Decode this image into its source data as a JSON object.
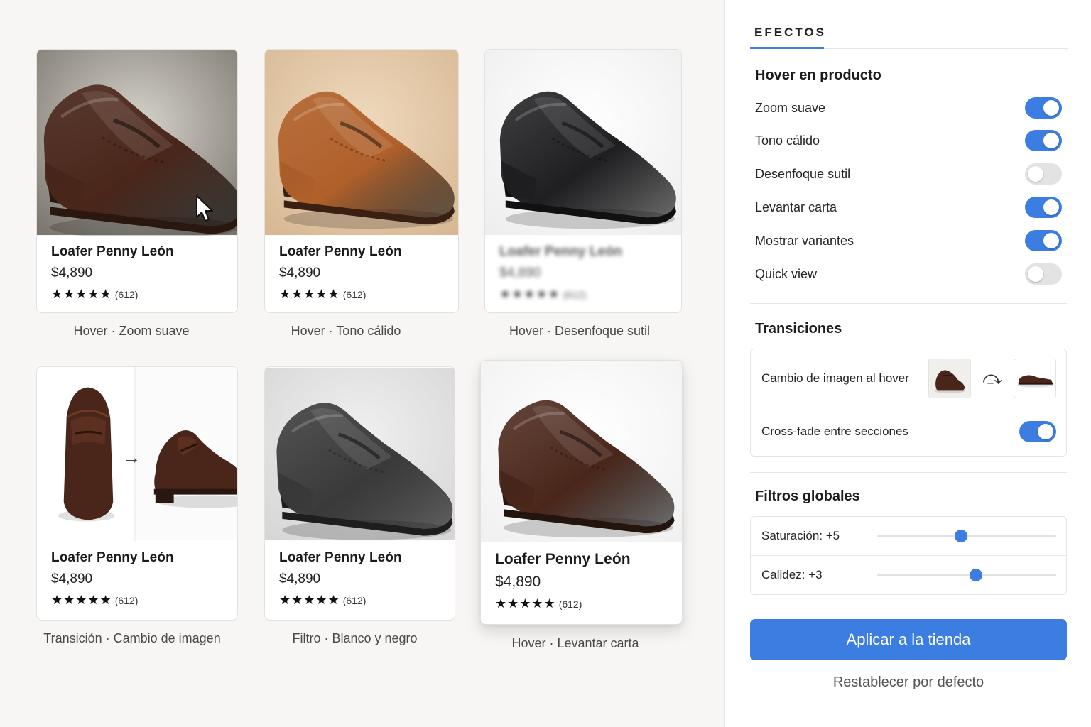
{
  "panel": {
    "title": "EFECTOS",
    "hover_section": "Hover en producto",
    "hover_toggles": [
      {
        "label": "Zoom suave",
        "on": true
      },
      {
        "label": "Tono cálido",
        "on": true
      },
      {
        "label": "Desenfoque sutil",
        "on": false
      },
      {
        "label": "Levantar carta",
        "on": true
      },
      {
        "label": "Mostrar variantes",
        "on": true
      },
      {
        "label": "Quick view",
        "on": false
      }
    ],
    "transitions_section": "Transiciones",
    "image_swap_label": "Cambio de imagen al hover",
    "crossfade_label": "Cross-fade entre secciones",
    "crossfade_on": true,
    "filters_section": "Filtros globales",
    "saturation_label": "Saturación: +5",
    "saturation_level": 0.47,
    "warmth_label": "Calidez: +3",
    "warmth_level": 0.55,
    "apply_label": "Aplicar a la tienda",
    "reset_label": "Restablecer por defecto"
  },
  "product": {
    "name": "Loafer Penny León",
    "price": "$4,890",
    "stars": "★★★★★",
    "reviews": "(612)"
  },
  "captions": [
    "Hover · Zoom suave",
    "Hover · Tono cálido",
    "Hover · Desenfoque sutil",
    "Transición · Cambio de imagen",
    "Filtro · Blanco y negro",
    "Hover · Levantar carta"
  ],
  "colors": {
    "accent": "#3b7de0",
    "leather_brown": "#4a261a",
    "leather_tan": "#b0602a",
    "leather_black": "#1f1f22",
    "leather_gray": "#3a3a3a"
  }
}
